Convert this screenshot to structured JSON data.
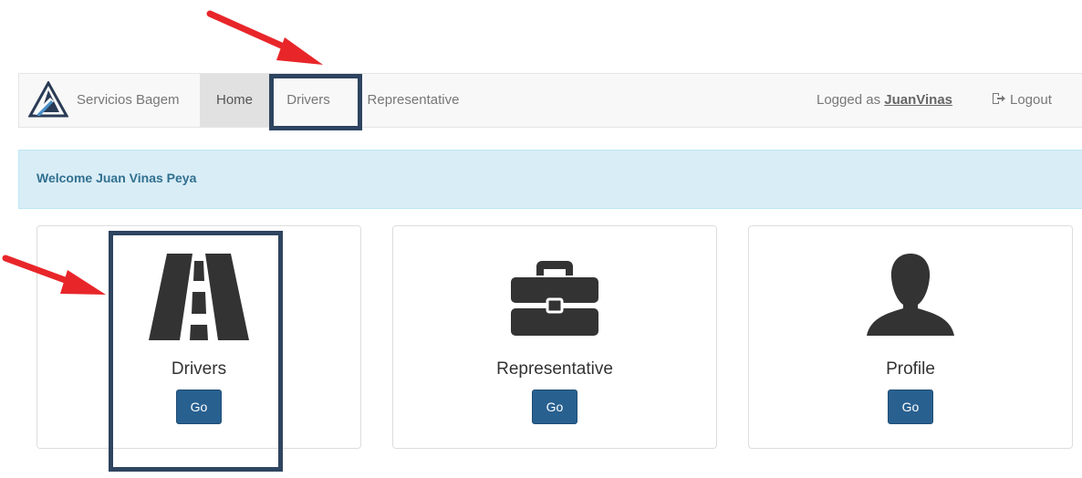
{
  "navbar": {
    "brand": "Servicios Bagem",
    "items": [
      {
        "label": "Home",
        "active": true
      },
      {
        "label": "Drivers",
        "active": false
      },
      {
        "label": "Representative",
        "active": false
      }
    ],
    "logged_as_prefix": "Logged as",
    "user": "JuanVinas",
    "logout": "Logout"
  },
  "welcome": {
    "text": "Welcome Juan Vinas Peya"
  },
  "cards": [
    {
      "title": "Drivers",
      "icon": "road-icon",
      "button": "Go"
    },
    {
      "title": "Representative",
      "icon": "briefcase-icon",
      "button": "Go"
    },
    {
      "title": "Profile",
      "icon": "user-icon",
      "button": "Go"
    }
  ],
  "colors": {
    "primary_button": "#286090",
    "welcome_bg": "#d9edf7",
    "welcome_text": "#31708f",
    "annotation_box": "#2e4460",
    "annotation_arrow": "#e8262a",
    "icon": "#333333"
  }
}
